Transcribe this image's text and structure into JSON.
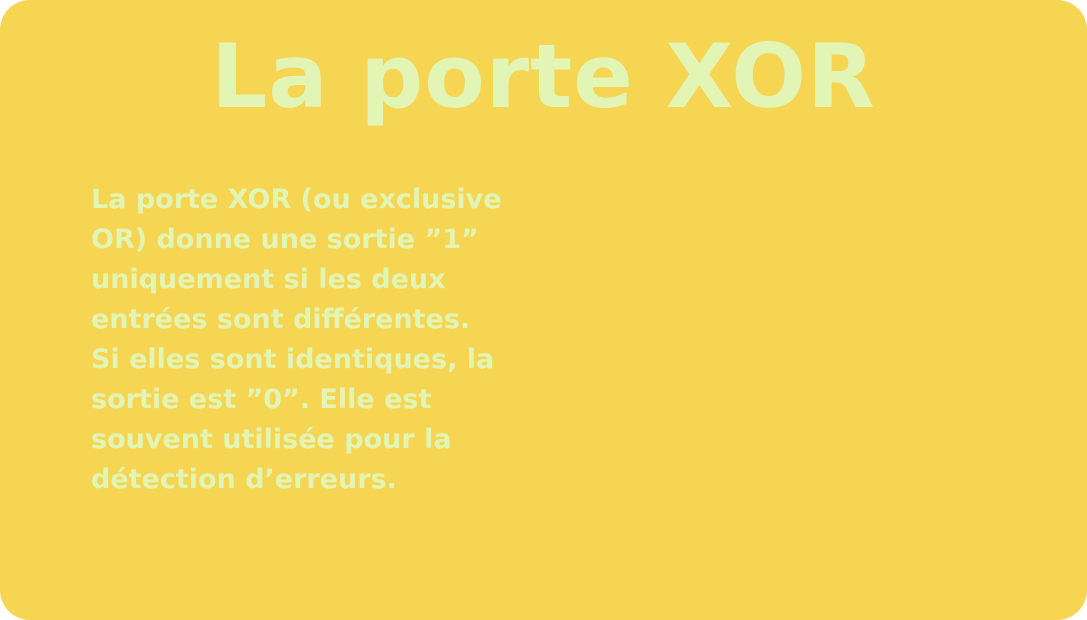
{
  "slide": {
    "title": "La porte XOR",
    "body": "La porte XOR (ou exclusive\nOR) donne une sortie ”1”\nuniquement si les deux\nentrées sont différentes.\nSi elles sont identiques, la\nsortie est ”0”. Elle est\nsouvent utilisée pour la\ndétection d’erreurs."
  },
  "colors": {
    "background": "#f5d552",
    "text": "#e2f5b4"
  }
}
